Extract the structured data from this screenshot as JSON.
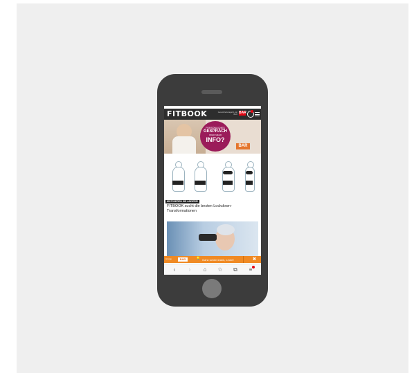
{
  "header": {
    "logo": "FITBOOK",
    "tagline": "Gesundheitsmagazin von BILD",
    "brand_badge": "BAR",
    "icons": [
      "user-icon",
      "menu-icon"
    ]
  },
  "ad": {
    "line1": "PERSÖNLICHES",
    "line2": "GESPRÄCH",
    "line3": "ODER MEHR",
    "line4": "INFO?",
    "brand": "BAR"
  },
  "article1": {
    "kicker": "MOTIVIEREN SIE ANDERE!",
    "title": "FITBOOK sucht die besten Lockdown-Transformationen"
  },
  "bottom_banner": {
    "label": "Anzeige",
    "brand": "BAR",
    "icon": "lightbulb-icon",
    "text": "Ganz schön krank, Leute!",
    "close": "✖"
  },
  "navbar": {
    "back": "‹",
    "forward": "›",
    "home": "⌂",
    "bookmark": "☆",
    "tabs": "⧉",
    "menu": "≡"
  }
}
